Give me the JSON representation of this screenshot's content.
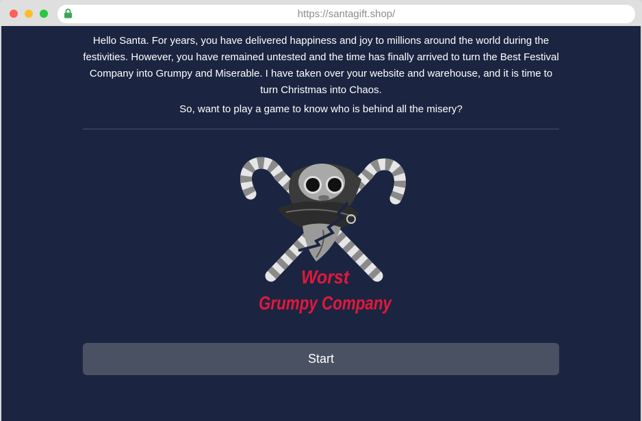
{
  "browser": {
    "url": "https://santagift.shop/",
    "icons": {
      "close": "close-window-icon",
      "minimize": "minimize-window-icon",
      "maximize": "maximize-window-icon",
      "secure": "lock-icon"
    },
    "colors": {
      "close": "#ff5f57",
      "minimize": "#febc2e",
      "maximize": "#28c840",
      "lock": "#3aa757"
    }
  },
  "page": {
    "intro_lines": [
      "Hello Santa. For years, you have delivered happiness and joy to millions around the world during the",
      "festivities. However, you have remained untested and the time has finally arrived to turn the Best Festival",
      "Company into Grumpy and Miserable. I have taken over your website and warehouse, and it is time to",
      "turn Christmas into Chaos."
    ],
    "question": "So, want to play a game to know who is behind all the misery?",
    "logo": {
      "icon": "crossed-candy-canes-grinch-logo",
      "line1": "Worst",
      "line2": "Grumpy Company"
    },
    "start_button": {
      "label": "Start"
    },
    "colors": {
      "background": "#1b2541",
      "text": "#ffffff",
      "divider": "#4a5470",
      "logo_text": "#e3183b",
      "button": "#4a5163"
    }
  }
}
